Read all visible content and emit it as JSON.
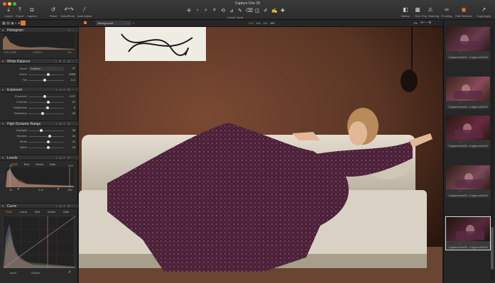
{
  "window": {
    "title": "Capture One 20"
  },
  "toolbar": {
    "left": [
      {
        "label": "Import",
        "icon": "import-icon"
      },
      {
        "label": "Export",
        "icon": "export-icon"
      },
      {
        "label": "Capture",
        "icon": "camera-icon"
      }
    ],
    "middle": [
      {
        "label": "Reset",
        "icon": "reset-icon"
      },
      {
        "label": "Undo/Redo",
        "icon": "undo-icon"
      },
      {
        "label": "Auto Adjust",
        "icon": "wand-icon"
      }
    ],
    "cursor_tools_label": "Cursor Tools",
    "right": [
      {
        "label": "Before",
        "icon": "before-icon"
      },
      {
        "label": "Grid",
        "icon": "grid-icon"
      },
      {
        "label": "Exp. Warning",
        "icon": "warning-icon"
      },
      {
        "label": "Proofing",
        "icon": "glasses-icon"
      },
      {
        "label": "Edit Selected",
        "icon": "edit-selected-icon"
      },
      {
        "label": "Copy/Apply",
        "icon": "copy-apply-icon"
      }
    ]
  },
  "subbar": {
    "layer": "Background",
    "rgb": {
      "r": "204",
      "g": "188",
      "b": "185",
      "l": "180"
    },
    "fit": "Fit",
    "counter": "1 of 9"
  },
  "left_panel": {
    "histogram": {
      "title": "Histogram",
      "iso": "ISO 1250",
      "shutter": "1/200 s",
      "aperture": "f/4"
    },
    "white_balance": {
      "title": "White Balance",
      "mode_label": "Mode",
      "mode_value": "Custom",
      "rows": [
        {
          "label": "Kelvin",
          "value": "4965",
          "pos": 0.55
        },
        {
          "label": "Tint",
          "value": "-5.4",
          "pos": 0.45
        }
      ]
    },
    "exposure": {
      "title": "Exposure",
      "rows": [
        {
          "label": "Exposure",
          "value": "-0.37",
          "pos": 0.46
        },
        {
          "label": "Contrast",
          "value": "12",
          "pos": 0.55
        },
        {
          "label": "Brightness",
          "value": "8",
          "pos": 0.53
        },
        {
          "label": "Saturation",
          "value": "-20",
          "pos": 0.4
        }
      ]
    },
    "hdr": {
      "title": "High Dynamic Range",
      "rows": [
        {
          "label": "Highlight",
          "value": "-28",
          "pos": 0.35
        },
        {
          "label": "Shadow",
          "value": "24",
          "pos": 0.6
        },
        {
          "label": "White",
          "value": "11",
          "pos": 0.55
        },
        {
          "label": "Black",
          "value": "15",
          "pos": 0.56
        }
      ]
    },
    "levels": {
      "title": "Levels",
      "tabs": [
        "RGB",
        "Red",
        "Green",
        "Blue"
      ],
      "left_top": "30",
      "right_top": "243",
      "left_bottom": "10",
      "mid_bottom": "0.11",
      "right_bottom": "250"
    },
    "curve": {
      "title": "Curve",
      "tabs": [
        "RGB",
        "Luma",
        "Red",
        "Green",
        "Blue"
      ],
      "input_label": "Input",
      "output_label": "Output"
    }
  },
  "browser": {
    "thumbs": [
      {
        "name": "CaptureOne20...l-high-res19.tif",
        "selected": false
      },
      {
        "name": "CaptureOne20...l-high-res20.tif",
        "selected": false
      },
      {
        "name": "CaptureOne20...l-high-res22.tif",
        "selected": false
      },
      {
        "name": "CaptureOne20...l-high-res23.tif",
        "selected": false
      },
      {
        "name": "CaptureOne20...l-high-res24.tif",
        "selected": true
      }
    ]
  },
  "colors": {
    "accent": "#e8772e",
    "panel": "#2a2a2a",
    "wall": "#5a3524",
    "sofa": "#d9d2c4",
    "dress": "#4a2238"
  }
}
